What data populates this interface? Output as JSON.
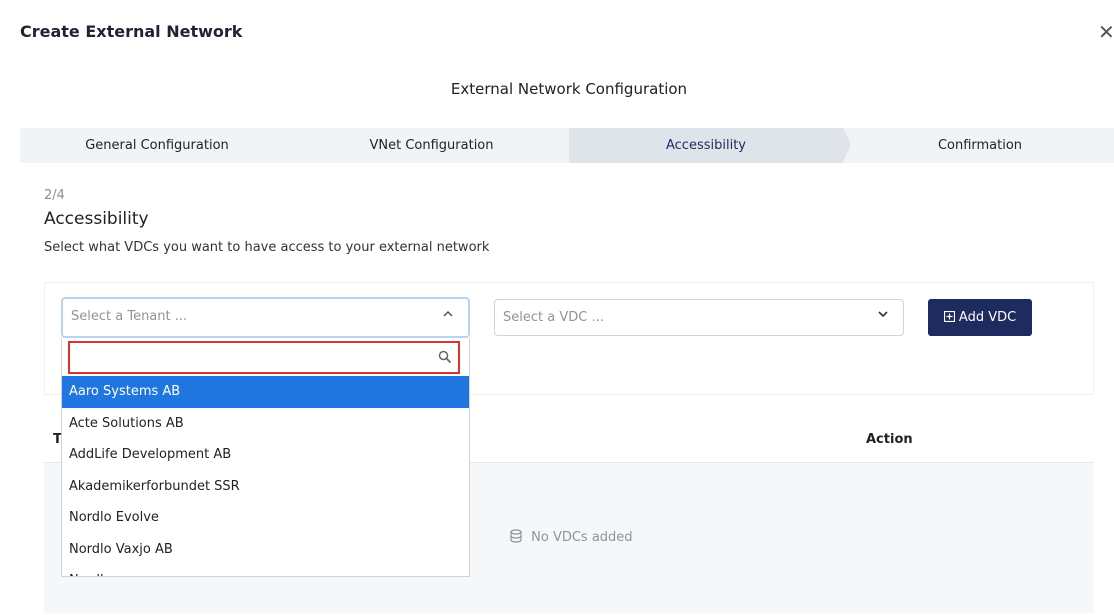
{
  "modal": {
    "title": "Create External Network",
    "close_icon": "close-icon"
  },
  "section_title": "External Network Configuration",
  "steps": [
    {
      "label": "General Configuration",
      "active": false
    },
    {
      "label": "VNet Configuration",
      "active": false
    },
    {
      "label": "Accessibility",
      "active": true
    },
    {
      "label": "Confirmation",
      "active": false
    }
  ],
  "page": {
    "step_count": "2/4",
    "heading": "Accessibility",
    "description": "Select what VDCs you want to have access to your external network"
  },
  "tenant_select": {
    "placeholder": "Select a Tenant ...",
    "search_value": "",
    "options": [
      "Aaro Systems AB",
      "Acte Solutions AB",
      "AddLife Development AB",
      "Akademikerforbundet SSR",
      "Nordlo Evolve",
      "Nordlo Vaxjo AB",
      "Nordlo ..."
    ],
    "highlighted_index": 0
  },
  "vdc_select": {
    "placeholder": "Select a VDC ..."
  },
  "add_vdc_button": {
    "label": "Add VDC",
    "icon": "plus-square-icon"
  },
  "table": {
    "columns": [
      "T",
      "Action"
    ],
    "empty_message": "No VDCs added",
    "empty_icon": "database-icon"
  },
  "colors": {
    "primary": "#1d2b5e",
    "highlight": "#1f76e0",
    "search_outline": "#d93030"
  }
}
